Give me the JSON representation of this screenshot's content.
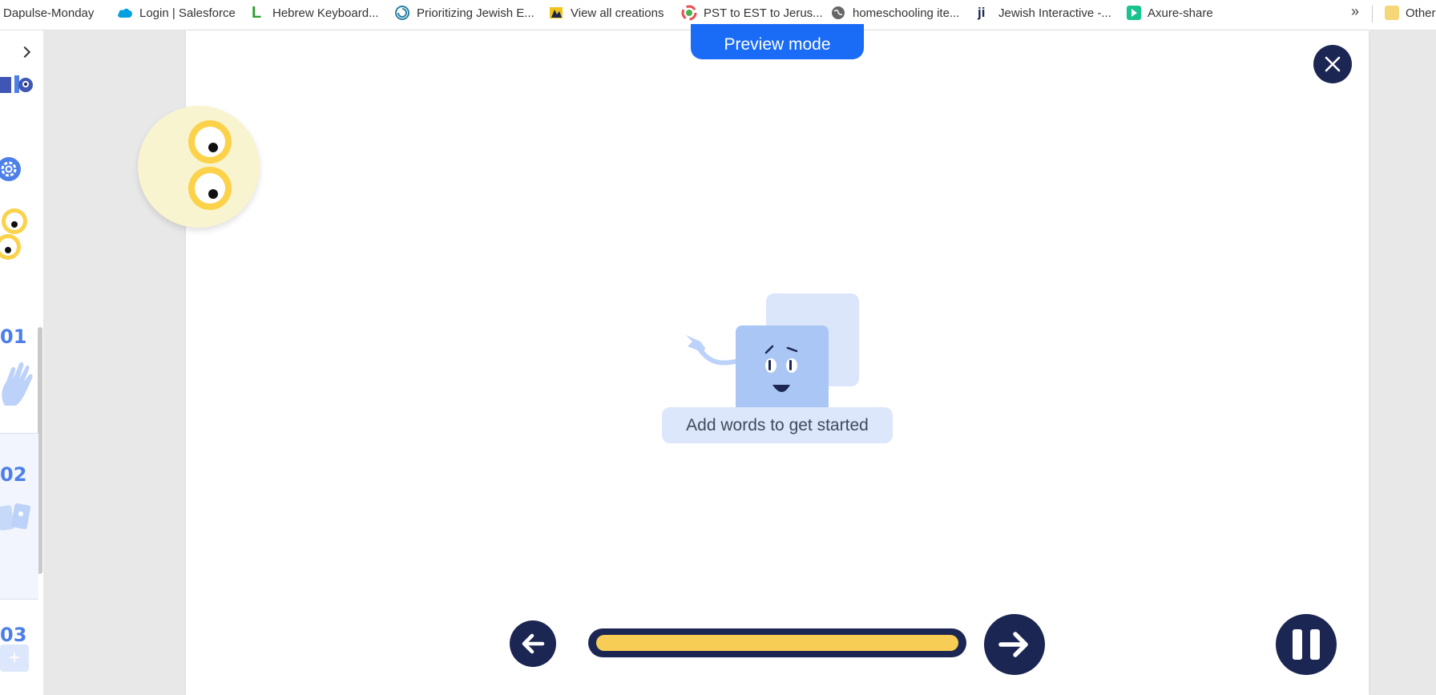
{
  "bookmarks": [
    {
      "label": "Dapulse-Monday",
      "icon": "monday-icon",
      "color": "#ff3d57"
    },
    {
      "label": "Login | Salesforce",
      "icon": "salesforce-cloud-icon",
      "color": "#00a1e0"
    },
    {
      "label": "Hebrew Keyboard...",
      "icon": "lexilogos-l-icon",
      "color": "#2e9e2e"
    },
    {
      "label": "Prioritizing Jewish E...",
      "icon": "spiral-icon",
      "color": "#2a7fa6"
    },
    {
      "label": "View all creations",
      "icon": "creations-icon",
      "color": "#f0c419"
    },
    {
      "label": "PST to EST to Jerus...",
      "icon": "timezone-clock-icon",
      "color": "#e94e4e"
    },
    {
      "label": "homeschooling ite...",
      "icon": "globe-icon",
      "color": "#555555"
    },
    {
      "label": "Jewish Interactive -...",
      "icon": "ji-icon",
      "color": "#1c2652"
    },
    {
      "label": "Axure-share",
      "icon": "axure-play-icon",
      "color": "#19c38f"
    },
    {
      "label": "Other",
      "icon": "folder-icon",
      "color": "#f5d77a"
    }
  ],
  "bookmarks_overflow": "»",
  "sidebar": {
    "slides": [
      {
        "number": "01",
        "icon": "wave-hand-icon"
      },
      {
        "number": "02",
        "icon": "cards-icon"
      },
      {
        "number": "03",
        "icon": "plus-icon"
      }
    ]
  },
  "canvas": {
    "preview_label": "Preview mode",
    "empty_message": "Add words to get started",
    "progress_fraction": 1.0
  },
  "colors": {
    "navy": "#1c2652",
    "accent_blue": "#1a6bf5",
    "progress_yellow": "#f7cd55",
    "slide_number_blue": "#4d7fe8"
  }
}
